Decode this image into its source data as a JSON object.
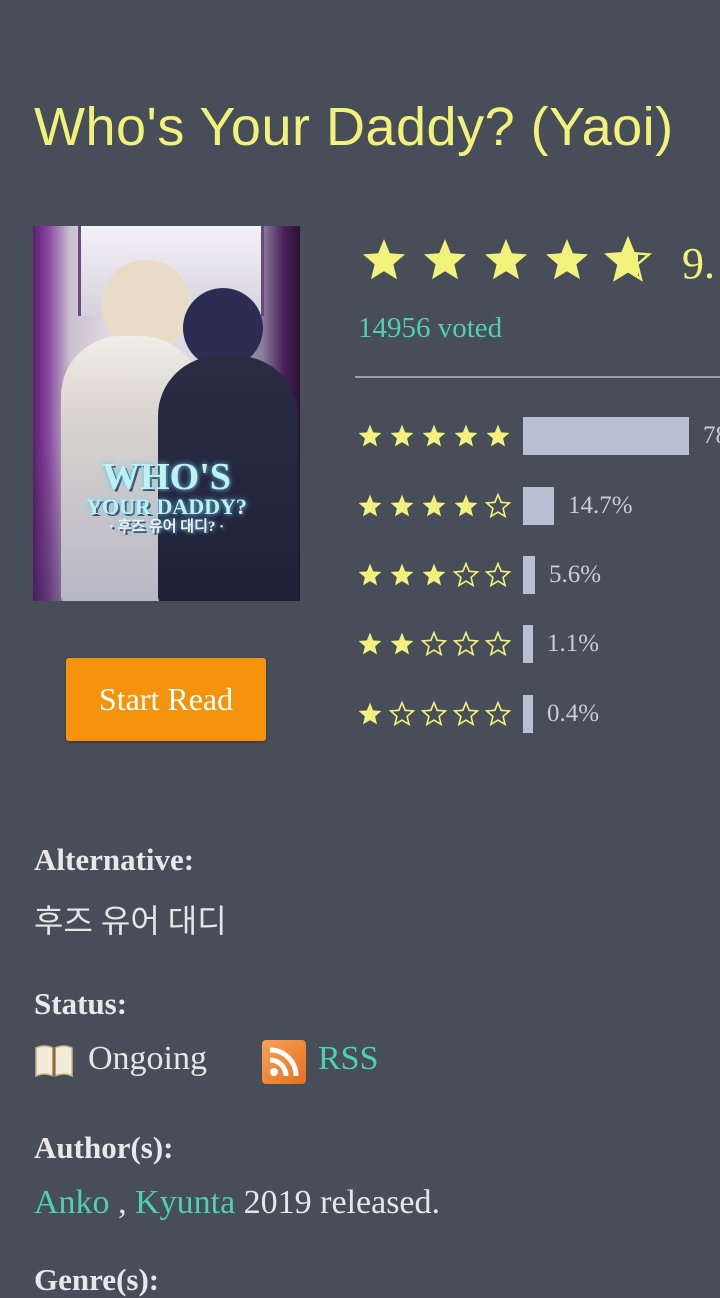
{
  "title": "Who's Your Daddy? (Yaoi)",
  "cover": {
    "logo_line1": "WHO'S",
    "logo_line2": "YOUR DADDY?",
    "logo_line3": "· 후즈 유어 대디? ·"
  },
  "rating": {
    "score_text": "9.",
    "stars_filled": 4.7,
    "voted": "14956 voted",
    "breakdown": [
      {
        "stars": 5,
        "percent": 78,
        "label": "78"
      },
      {
        "stars": 4,
        "percent": 14.7,
        "label": "14.7%"
      },
      {
        "stars": 3,
        "percent": 5.6,
        "label": "5.6%"
      },
      {
        "stars": 2,
        "percent": 1.1,
        "label": "1.1%"
      },
      {
        "stars": 1,
        "percent": 0.4,
        "label": "0.4%"
      }
    ]
  },
  "start_button": "Start Read",
  "info": {
    "alternative_label": "Alternative:",
    "alternative_value": "후즈 유어 대디",
    "status_label": "Status:",
    "status_icon": "book-icon",
    "status_value": "Ongoing",
    "rss_icon": "rss-icon",
    "rss_label": "RSS",
    "authors_label": "Author(s):",
    "authors": [
      "Anko",
      "Kyunta"
    ],
    "author_separator": " , ",
    "released_text": " 2019 released.",
    "next_label": "Genre(s):"
  },
  "colors": {
    "background": "#474d59",
    "title": "#f2f27a",
    "star": "#f2f27a",
    "link": "#4fd0b0",
    "button": "#f5930c",
    "bar": "#b9c0d3"
  }
}
